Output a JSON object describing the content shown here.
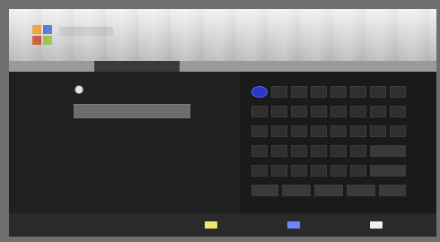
{
  "header": {
    "logo": {
      "icon": "colored-squares-logo"
    }
  },
  "tabs": [
    {
      "label": ""
    },
    {
      "label": ""
    },
    {
      "label": ""
    },
    {
      "label": ""
    },
    {
      "label": ""
    }
  ],
  "form": {
    "radio_label": "",
    "input_value": ""
  },
  "keyboard": {
    "keys": [
      {
        "label": ""
      },
      {
        "label": ""
      },
      {
        "label": ""
      },
      {
        "label": ""
      },
      {
        "label": ""
      },
      {
        "label": ""
      },
      {
        "label": ""
      },
      {
        "label": ""
      },
      {
        "label": ""
      },
      {
        "label": ""
      },
      {
        "label": ""
      },
      {
        "label": ""
      },
      {
        "label": ""
      },
      {
        "label": ""
      },
      {
        "label": ""
      },
      {
        "label": ""
      },
      {
        "label": ""
      },
      {
        "label": ""
      },
      {
        "label": ""
      },
      {
        "label": ""
      },
      {
        "label": ""
      },
      {
        "label": ""
      },
      {
        "label": ""
      },
      {
        "label": ""
      },
      {
        "label": ""
      },
      {
        "label": ""
      },
      {
        "label": ""
      },
      {
        "label": ""
      },
      {
        "label": ""
      },
      {
        "label": ""
      },
      {
        "label": ""
      },
      {
        "label": ""
      },
      {
        "label": ""
      },
      {
        "label": ""
      },
      {
        "label": ""
      },
      {
        "label": ""
      },
      {
        "label": ""
      },
      {
        "label": ""
      },
      {
        "label": ""
      },
      {
        "label": ""
      },
      {
        "label": ""
      },
      {
        "label": ""
      },
      {
        "label": ""
      },
      {
        "label": ""
      },
      {
        "label": ""
      },
      {
        "label": ""
      },
      {
        "label": ""
      },
      {
        "label": ""
      }
    ]
  },
  "footer": {
    "buttons": [
      {
        "color": "#f0e76f",
        "label": ""
      },
      {
        "color": "#6f85ff",
        "label": ""
      },
      {
        "color": "#efefef",
        "label": ""
      }
    ]
  }
}
